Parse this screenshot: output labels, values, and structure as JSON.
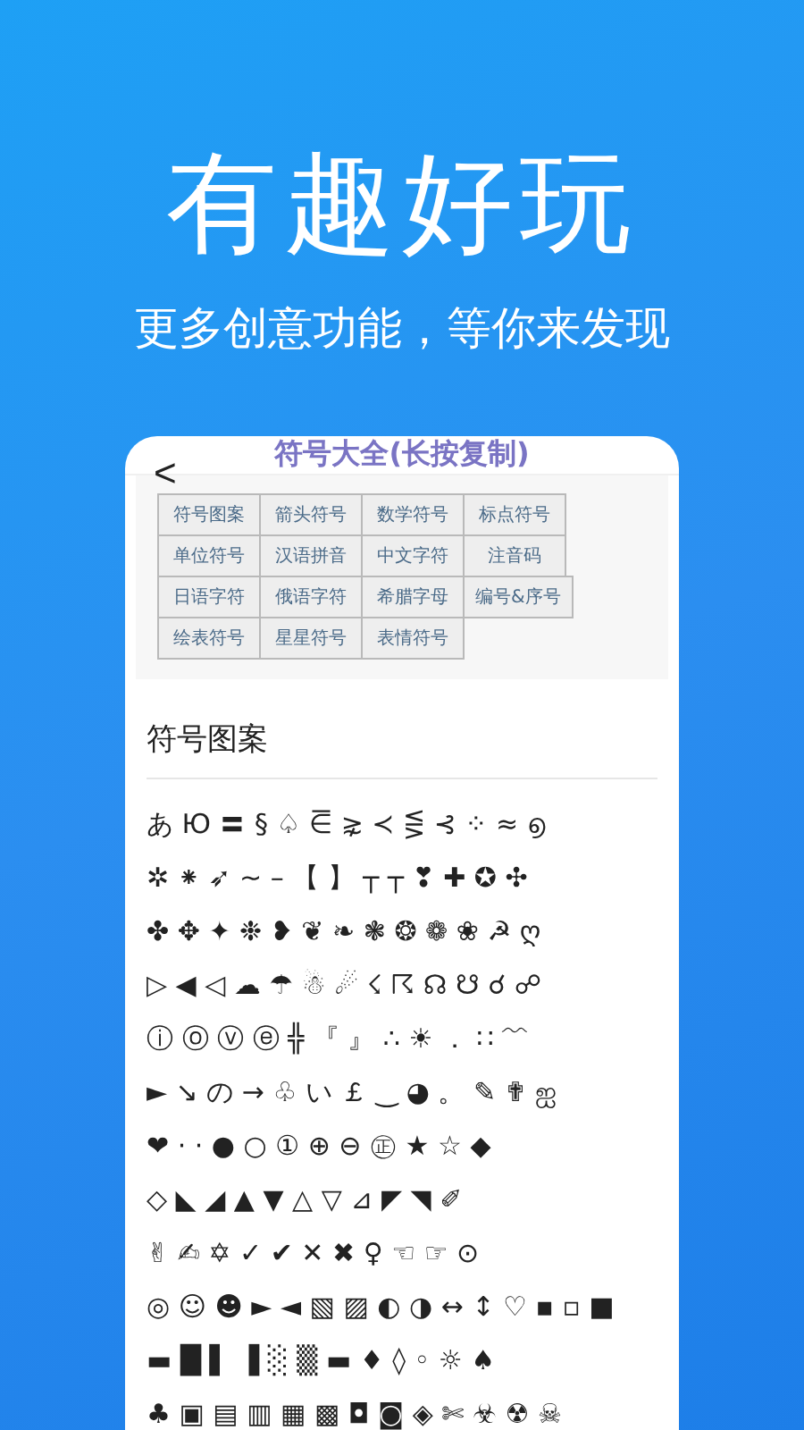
{
  "headline": "有趣好玩",
  "subtitle": "更多创意功能，等你来发现",
  "screen": {
    "back": "<",
    "title": "符号大全(长按复制)",
    "categories": [
      [
        "符号图案",
        "箭头符号",
        "数学符号",
        "标点符号"
      ],
      [
        "单位符号",
        "汉语拼音",
        "中文字符",
        "注音码"
      ],
      [
        "日语字符",
        "俄语字符",
        "希腊字母",
        "编号&序号"
      ],
      [
        "绘表符号",
        "星星符号",
        "表情符号"
      ]
    ],
    "section_title": "符号图案",
    "symbol_rows": [
      "あ Ю 〓 § ♤ ⋶ ⋧ ≺ ⋚ ⊰ ⁘ ≈ ൭",
      "✲ ⁕ ➶ ~ – 【 】 ┬ ┬ ❣ ✚ ✪ ✣",
      "✤ ✥ ✦ ❉ ❥ ❦ ❧ ❃ ❂ ❁ ❀ ☭ ღ",
      "▷ ◀ ◁ ☁ ☂ ☃ ☄ ☇ ☈ ☊ ☋ ☌ ☍",
      "ⓘ ⓞ ⓥ ⓔ ╬ 『 』 ∴ ☀ ． ∷ ﹌",
      "► ↘ の → ♧ い ￡ ‿ ◕ 。 ✎ ✟ ஐ",
      "❤ · · ● ○ ① ⊕ ⊖ ㊣ ★ ☆ ◆",
      "◇ ◣ ◢ ▲ ▼ △ ▽ ⊿ ◤ ◥ ✐",
      "✌ ✍ ✡ ✓ ✔ ✕ ✖ ♀ ☜ ☞ ⊙",
      "◎ ☺ ☻ ► ◄ ▧ ▨ ◐ ◑ ↔ ↕ ♡ ▪ ▫ ■",
      "▬ █ ▌ ▐ ░ ▒ ▬ ♦ ◊ ◦ ☼ ♠",
      "♣ ▣ ▤ ▥ ▦ ▩ ◘ ◙ ◈ ✄ ☣ ☢ ☠"
    ]
  }
}
